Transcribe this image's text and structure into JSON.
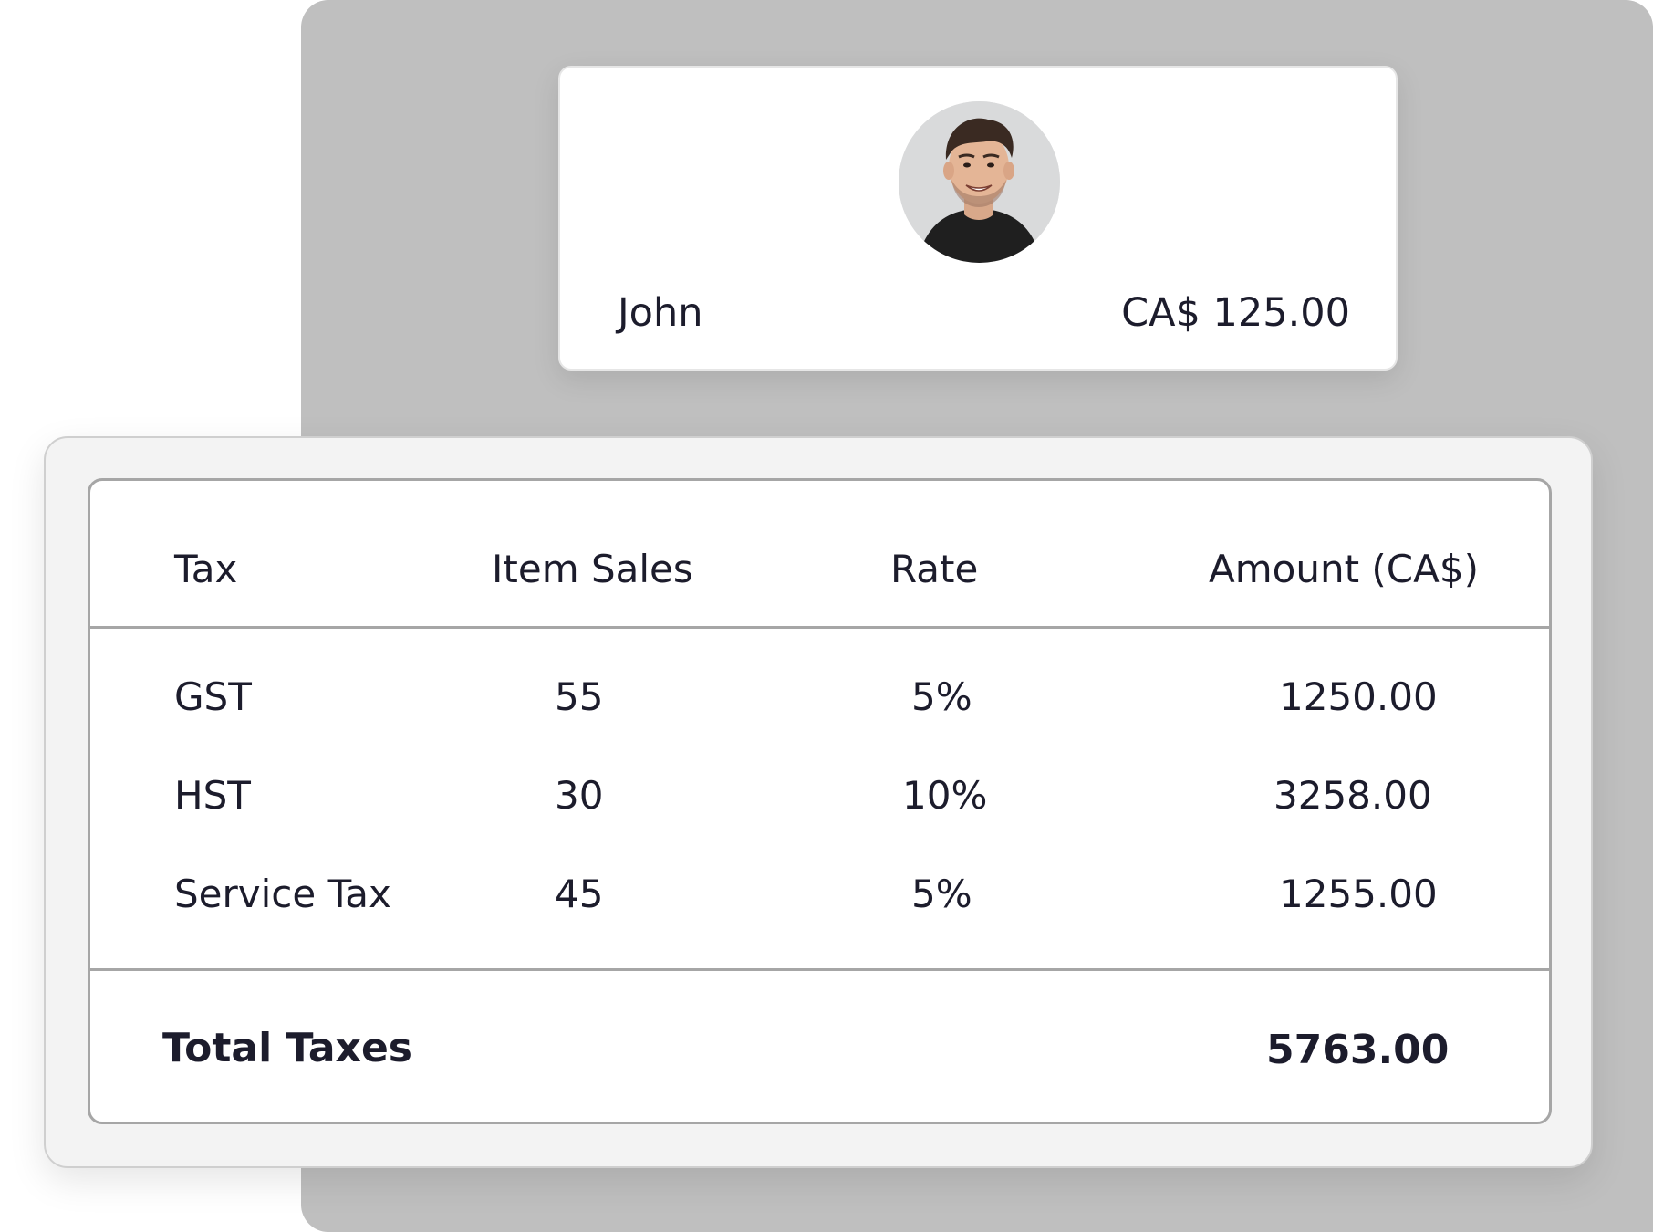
{
  "profile": {
    "name": "John",
    "amount": "CA$ 125.00",
    "avatar_icon": "user-avatar-photo"
  },
  "tax_table": {
    "headers": [
      "Tax",
      "Item Sales",
      "Rate",
      "Amount (CA$)"
    ],
    "rows": [
      {
        "tax": "GST",
        "item_sales": "55",
        "rate": "5%",
        "amount": "1250.00"
      },
      {
        "tax": "HST",
        "item_sales": "30",
        "rate": "10%",
        "amount": "3258.00"
      },
      {
        "tax": "Service Tax",
        "item_sales": "45",
        "rate": "5%",
        "amount": "1255.00"
      }
    ],
    "total_label": "Total Taxes",
    "total_amount": "5763.00"
  },
  "colors": {
    "backdrop": "#bfbfbf",
    "text": "#1c1c2c",
    "border": "#a6a6a6"
  }
}
